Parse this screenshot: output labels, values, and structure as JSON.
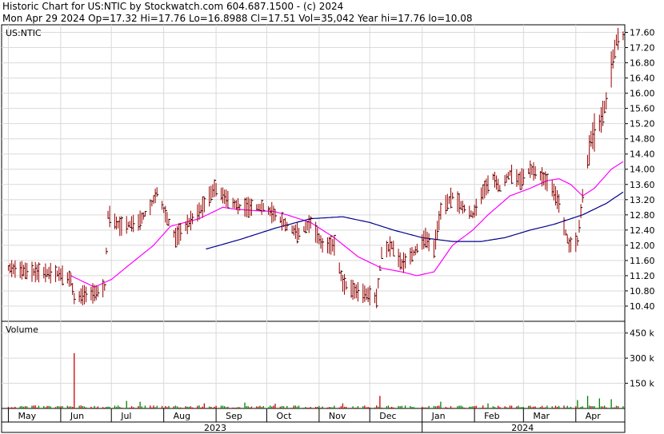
{
  "header": {
    "line1": "Historic Chart for US:NTIC by Stockwatch.com 604.687.1500 - (c) 2024",
    "line2": "Mon Apr 29 2024  Op=17.32  Hi=17.76  Lo=16.8988  Cl=17.51  Vol=35,042  Year hi=17.76  lo=10.08"
  },
  "chart_data": [
    {
      "type": "ohlc",
      "symbol_label": "US:NTIC",
      "ylim": [
        10.0,
        17.8
      ],
      "y_ticks": [
        "17.60",
        "17.20",
        "16.80",
        "16.40",
        "16.00",
        "15.60",
        "15.20",
        "14.80",
        "14.40",
        "14.00",
        "13.60",
        "13.20",
        "12.80",
        "12.40",
        "12.00",
        "11.60",
        "11.20",
        "10.80",
        "10.40"
      ],
      "grid": true,
      "colors": {
        "bars": "#990000",
        "ma_fast": "#ff00ff",
        "ma_slow": "#00008b",
        "grid": "#d9d9d9"
      },
      "price_anchors": [
        [
          "2023-05-01",
          11.4
        ],
        [
          "2023-05-15",
          11.3
        ],
        [
          "2023-05-31",
          11.25
        ],
        [
          "2023-06-07",
          11.1
        ],
        [
          "2023-06-09",
          10.6
        ],
        [
          "2023-06-15",
          10.7
        ],
        [
          "2023-06-22",
          10.75
        ],
        [
          "2023-06-27",
          10.9
        ],
        [
          "2023-06-29",
          12.8
        ],
        [
          "2023-07-06",
          12.5
        ],
        [
          "2023-07-17",
          12.6
        ],
        [
          "2023-07-24",
          13.0
        ],
        [
          "2023-07-28",
          13.4
        ],
        [
          "2023-08-03",
          12.7
        ],
        [
          "2023-08-08",
          12.2
        ],
        [
          "2023-08-16",
          12.6
        ],
        [
          "2023-08-24",
          13.0
        ],
        [
          "2023-08-31",
          13.5
        ],
        [
          "2023-09-08",
          13.2
        ],
        [
          "2023-09-15",
          13.0
        ],
        [
          "2023-09-25",
          13.0
        ],
        [
          "2023-09-29",
          13.0
        ],
        [
          "2023-10-06",
          12.8
        ],
        [
          "2023-10-13",
          12.5
        ],
        [
          "2023-10-20",
          12.3
        ],
        [
          "2023-10-27",
          12.6
        ],
        [
          "2023-11-03",
          12.0
        ],
        [
          "2023-11-10",
          12.0
        ],
        [
          "2023-11-15",
          11.0
        ],
        [
          "2023-11-22",
          10.8
        ],
        [
          "2023-11-30",
          10.7
        ],
        [
          "2023-12-05",
          10.6
        ],
        [
          "2023-12-08",
          11.8
        ],
        [
          "2023-12-14",
          12.0
        ],
        [
          "2023-12-20",
          11.5
        ],
        [
          "2023-12-27",
          11.8
        ],
        [
          "2024-01-03",
          12.2
        ],
        [
          "2024-01-08",
          11.9
        ],
        [
          "2024-01-12",
          12.9
        ],
        [
          "2024-01-19",
          13.3
        ],
        [
          "2024-01-25",
          13.0
        ],
        [
          "2024-01-31",
          12.8
        ],
        [
          "2024-02-06",
          13.4
        ],
        [
          "2024-02-12",
          13.8
        ],
        [
          "2024-02-16",
          13.5
        ],
        [
          "2024-02-22",
          13.9
        ],
        [
          "2024-02-28",
          13.7
        ],
        [
          "2024-03-05",
          14.0
        ],
        [
          "2024-03-12",
          13.8
        ],
        [
          "2024-03-18",
          13.5
        ],
        [
          "2024-03-22",
          13.1
        ],
        [
          "2024-03-25",
          12.5
        ],
        [
          "2024-03-28",
          12.0
        ],
        [
          "2024-04-02",
          12.1
        ],
        [
          "2024-04-05",
          13.3
        ],
        [
          "2024-04-10",
          14.8
        ],
        [
          "2024-04-16",
          15.3
        ],
        [
          "2024-04-19",
          15.8
        ],
        [
          "2024-04-23",
          16.9
        ],
        [
          "2024-04-25",
          17.4
        ],
        [
          "2024-04-29",
          17.51
        ]
      ],
      "ma_fast_anchors": [
        [
          "2023-06-07",
          11.2
        ],
        [
          "2023-06-21",
          10.9
        ],
        [
          "2023-07-01",
          11.1
        ],
        [
          "2023-07-12",
          11.5
        ],
        [
          "2023-07-26",
          12.0
        ],
        [
          "2023-08-05",
          12.5
        ],
        [
          "2023-08-22",
          12.7
        ],
        [
          "2023-09-05",
          13.0
        ],
        [
          "2023-09-12",
          12.95
        ],
        [
          "2023-09-28",
          12.9
        ],
        [
          "2023-10-04",
          12.9
        ],
        [
          "2023-10-13",
          12.8
        ],
        [
          "2023-10-27",
          12.6
        ],
        [
          "2023-11-10",
          12.2
        ],
        [
          "2023-11-24",
          11.7
        ],
        [
          "2023-12-08",
          11.4
        ],
        [
          "2023-12-20",
          11.3
        ],
        [
          "2023-12-29",
          11.2
        ],
        [
          "2024-01-08",
          11.3
        ],
        [
          "2024-01-19",
          12.0
        ],
        [
          "2024-01-31",
          12.4
        ],
        [
          "2024-02-09",
          12.8
        ],
        [
          "2024-02-22",
          13.3
        ],
        [
          "2024-03-05",
          13.5
        ],
        [
          "2024-03-15",
          13.7
        ],
        [
          "2024-03-22",
          13.75
        ],
        [
          "2024-03-29",
          13.6
        ],
        [
          "2024-04-05",
          13.3
        ],
        [
          "2024-04-12",
          13.5
        ],
        [
          "2024-04-22",
          14.0
        ],
        [
          "2024-04-29",
          14.2
        ]
      ],
      "ma_slow_anchors": [
        [
          "2023-08-26",
          11.9
        ],
        [
          "2023-09-15",
          12.15
        ],
        [
          "2023-10-06",
          12.45
        ],
        [
          "2023-10-27",
          12.7
        ],
        [
          "2023-11-15",
          12.75
        ],
        [
          "2023-12-01",
          12.6
        ],
        [
          "2023-12-15",
          12.4
        ],
        [
          "2024-01-01",
          12.2
        ],
        [
          "2024-01-19",
          12.1
        ],
        [
          "2024-02-05",
          12.1
        ],
        [
          "2024-02-19",
          12.2
        ],
        [
          "2024-03-05",
          12.4
        ],
        [
          "2024-03-19",
          12.55
        ],
        [
          "2024-04-05",
          12.8
        ],
        [
          "2024-04-19",
          13.1
        ],
        [
          "2024-04-29",
          13.4
        ]
      ]
    },
    {
      "type": "volume",
      "title": "Volume",
      "ylim": [
        0,
        520
      ],
      "unit": "k",
      "y_ticks": [
        "450 k",
        "300 k",
        "150 k"
      ],
      "colors": {
        "up": "#008000",
        "down": "#cc0000"
      },
      "spikes": [
        [
          "2023-06-09",
          330,
          "down"
        ],
        [
          "2023-07-10",
          45,
          "up"
        ],
        [
          "2023-07-18",
          40,
          "up"
        ],
        [
          "2023-08-25",
          30,
          "down"
        ],
        [
          "2023-09-18",
          35,
          "up"
        ],
        [
          "2023-10-06",
          28,
          "down"
        ],
        [
          "2023-11-15",
          30,
          "down"
        ],
        [
          "2023-12-07",
          75,
          "down"
        ],
        [
          "2024-01-12",
          40,
          "up"
        ],
        [
          "2024-02-09",
          30,
          "up"
        ],
        [
          "2024-04-02",
          50,
          "up"
        ],
        [
          "2024-04-08",
          75,
          "up"
        ],
        [
          "2024-04-15",
          60,
          "up"
        ],
        [
          "2024-04-22",
          55,
          "up"
        ]
      ],
      "base_level": 12
    }
  ],
  "time_axis": {
    "months": [
      {
        "label": "May",
        "date": "2023-05-01"
      },
      {
        "label": "Jun",
        "date": "2023-06-01"
      },
      {
        "label": "Jul",
        "date": "2023-07-01"
      },
      {
        "label": "Aug",
        "date": "2023-08-01"
      },
      {
        "label": "Sep",
        "date": "2023-09-01"
      },
      {
        "label": "Oct",
        "date": "2023-10-01"
      },
      {
        "label": "Nov",
        "date": "2023-11-01"
      },
      {
        "label": "Dec",
        "date": "2023-12-01"
      },
      {
        "label": "Jan",
        "date": "2024-01-01"
      },
      {
        "label": "Feb",
        "date": "2024-02-01"
      },
      {
        "label": "Mar",
        "date": "2024-03-01"
      },
      {
        "label": "Apr",
        "date": "2024-04-01"
      }
    ],
    "years": [
      {
        "label": "2023",
        "from": "2023-05-01",
        "to": "2024-01-01"
      },
      {
        "label": "2024",
        "from": "2024-01-01",
        "to": "2024-04-29"
      }
    ],
    "range": [
      "2023-04-27",
      "2024-04-30"
    ]
  }
}
